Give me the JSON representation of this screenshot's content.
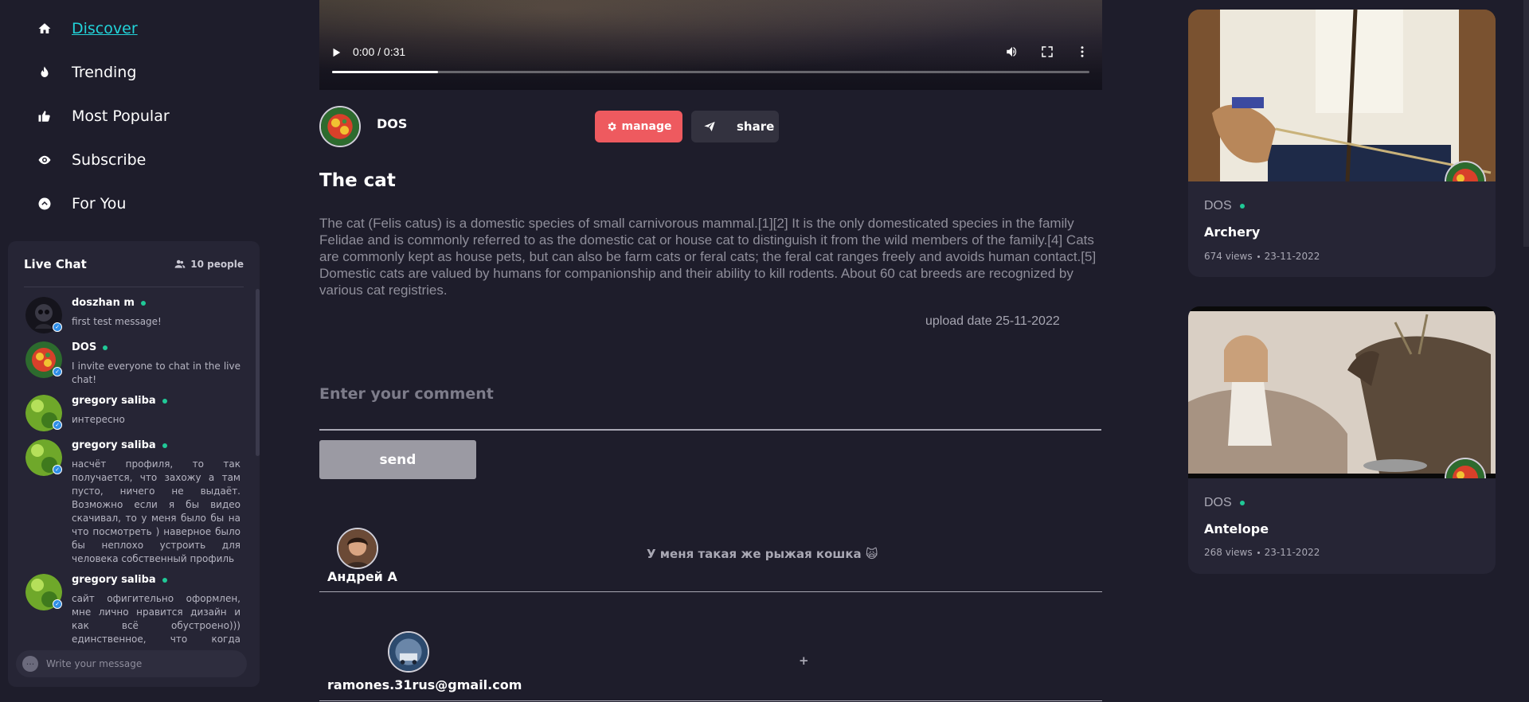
{
  "nav": [
    {
      "label": "Discover",
      "icon": "home-icon"
    },
    {
      "label": "Trending",
      "icon": "flame-icon"
    },
    {
      "label": "Most Popular",
      "icon": "thumbs-up-icon"
    },
    {
      "label": "Subscribe",
      "icon": "eye-icon"
    },
    {
      "label": "For You",
      "icon": "chevron-up-circle-icon"
    }
  ],
  "chat": {
    "title": "Live Chat",
    "people": "10 people",
    "placeholder": "Write your message",
    "messages": [
      {
        "name": "doszhan m",
        "text": "first test message!"
      },
      {
        "name": "DOS",
        "text": "I invite everyone to chat in the live chat!"
      },
      {
        "name": "gregory saliba",
        "text": "интересно"
      },
      {
        "name": "gregory saliba",
        "text": "насчёт профиля, то так получается, что захожу а там пусто, ничего не выдаёт. Возможно если я бы видео скачивал, то у меня было бы на что посмотреть ) наверное было бы неплохо устроить для человека собственный профиль"
      },
      {
        "name": "gregory saliba",
        "text": "сайт офигительно оформлен, мне лично нравится дизайн и как всё обустроено))) единственное, что когда пишешь в чат то с"
      }
    ]
  },
  "video": {
    "time": "0:00 / 0:31",
    "progress": 0.14,
    "buffered": 0.14,
    "channel": "DOS",
    "manage_label": "manage",
    "share_label": "share",
    "title": "The cat",
    "description": "The cat (Felis catus) is a domestic species of small carnivorous mammal.[1][2] It is the only domesticated species in the family Felidae and is commonly referred to as the domestic cat or house cat to distinguish it from the wild members of the family.[4] Cats are commonly kept as house pets, but can also be farm cats or feral cats; the feral cat ranges freely and avoids human contact.[5] Domestic cats are valued by humans for companionship and their ability to kill rodents. About 60 cat breeds are recognized by various cat registries.",
    "upload_date": "upload date 25-11-2022"
  },
  "comment_form": {
    "placeholder": "Enter your comment",
    "send_label": "send"
  },
  "comments": [
    {
      "author": "Андрей А",
      "text": "У меня такая же рыжая кошка 🙀"
    },
    {
      "author": "ramones.31rus@gmail.com",
      "text": "+"
    }
  ],
  "recommended": [
    {
      "channel": "DOS",
      "title": "Archery",
      "views": "674 views",
      "date": "23-11-2022"
    },
    {
      "channel": "DOS",
      "title": "Antelope",
      "views": "268 views",
      "date": "23-11-2022"
    }
  ],
  "colors": {
    "background": "#1e1d2b",
    "panel": "#262535",
    "accent": "#22d3d9",
    "manage": "#ee5a5f",
    "online": "#20c997"
  }
}
